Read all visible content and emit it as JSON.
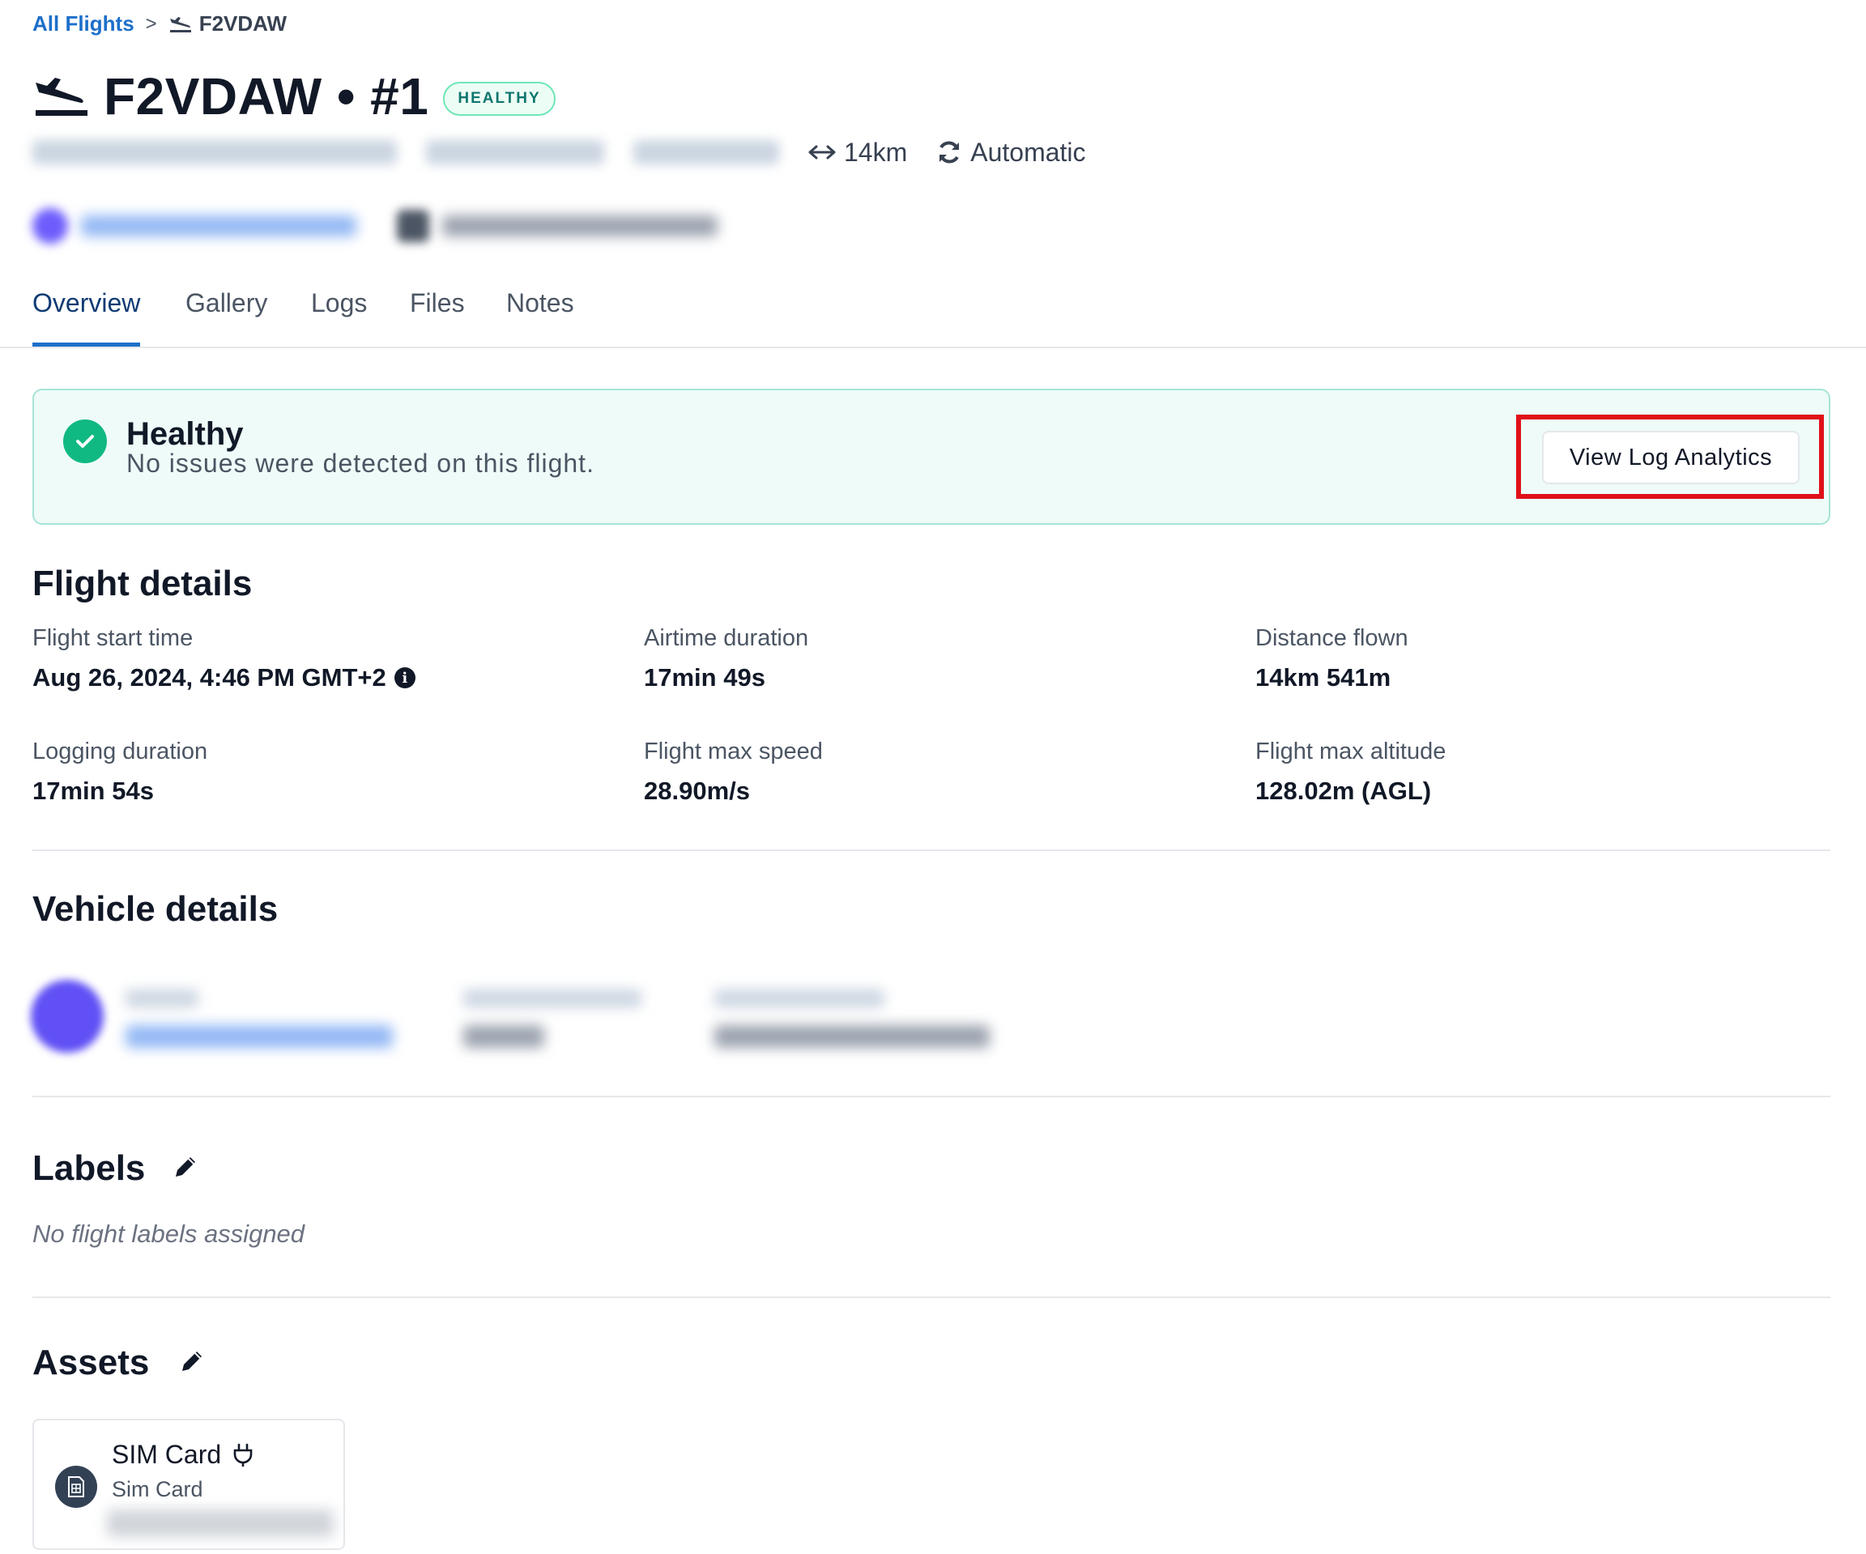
{
  "breadcrumb": {
    "root": "All Flights",
    "separator": ">",
    "current": "F2VDAW"
  },
  "header": {
    "title": "F2VDAW • #1",
    "status_badge": "HEALTHY",
    "meta": {
      "distance": "14km",
      "sync_mode": "Automatic"
    }
  },
  "tabs": [
    "Overview",
    "Gallery",
    "Logs",
    "Files",
    "Notes"
  ],
  "active_tab": "Overview",
  "health": {
    "title": "Healthy",
    "message": "No issues were detected on this flight.",
    "button": "View Log Analytics"
  },
  "flight_details": {
    "title": "Flight details",
    "items": [
      {
        "label": "Flight start time",
        "value": "Aug 26, 2024, 4:46 PM GMT+2"
      },
      {
        "label": "Airtime duration",
        "value": "17min 49s"
      },
      {
        "label": "Distance flown",
        "value": "14km 541m"
      },
      {
        "label": "Logging duration",
        "value": "17min 54s"
      },
      {
        "label": "Flight max speed",
        "value": "28.90m/s"
      },
      {
        "label": "Flight max altitude",
        "value": "128.02m (AGL)"
      }
    ]
  },
  "vehicle_details": {
    "title": "Vehicle details"
  },
  "labels": {
    "title": "Labels",
    "empty": "No flight labels assigned"
  },
  "assets": {
    "title": "Assets",
    "cards": [
      {
        "name": "SIM Card",
        "type": "Sim Card"
      }
    ]
  },
  "colors": {
    "accent": "#1d6fc9",
    "healthy": "#10b981",
    "highlight": "#e0101a"
  },
  "icons": [
    "plane-landing-icon",
    "arrows-horizontal-icon",
    "sync-icon",
    "check-icon",
    "info-icon",
    "pencil-icon",
    "sim-card-icon",
    "plug-icon"
  ]
}
